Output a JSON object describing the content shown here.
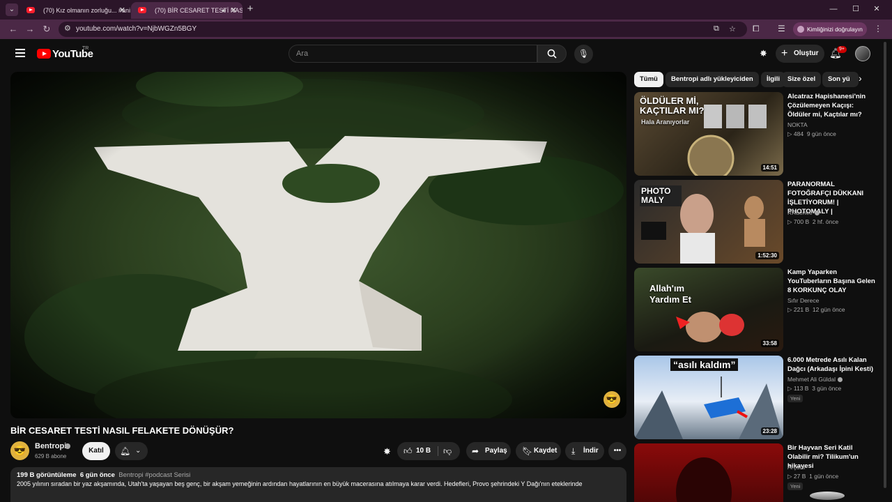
{
  "browser": {
    "tabs": [
      {
        "title": "(70) Kız olmanın zorluğu... #ani",
        "active": false
      },
      {
        "title": "(70) BİR CESARET TESTİ NASIL FELAKETE DÖNÜŞÜR?",
        "active": true
      }
    ],
    "url": "youtube.com/watch?v=NjbWGZn5BGY",
    "verify_label": "Kimliğinizi doğrulayın"
  },
  "header": {
    "logo": "YouTube",
    "country_code": "TR",
    "search_placeholder": "Ara",
    "create_label": "Oluştur",
    "notifications": "9+"
  },
  "video": {
    "title": "BİR CESARET TESTİ NASIL FELAKETE DÖNÜŞÜR?",
    "channel": "Bentropi",
    "subscribers": "629 B abone",
    "join_label": "Katıl",
    "likes": "10 B",
    "share_label": "Paylaş",
    "save_label": "Kaydet",
    "download_label": "İndir",
    "views": "199 B görüntüleme",
    "date": "6 gün önce",
    "tags": "Bentropi  #podcast Serisi",
    "description": "2005 yılının sıradan bir yaz akşamında, Utah'ta yaşayan beş genç, bir akşam yemeğinin ardından hayatlarının en büyük macerasına atılmaya karar verdi. Hedefleri, Provo şehrindeki Y Dağı'nın eteklerinde"
  },
  "chips": [
    "Tümü",
    "Bentropi adlı yükleyiciden",
    "İlgili",
    "Size özel",
    "Son yü"
  ],
  "recommendations": [
    {
      "title": "Alcatraz Hapishanesi'nin Çözülemeyen Kaçışı: Öldüler mi, Kaçtılar mı?",
      "channel": "NOKTA",
      "views": "▷ 484",
      "age": "9 gün önce",
      "duration": "14:51",
      "thumb_text": "ÖLDÜLER Mİ, KAÇTILAR MI?",
      "thumb_sub": "Hala Aranıyorlar",
      "verified": false,
      "new": ""
    },
    {
      "title": "PARANORMAL FOTOĞRAFÇI DÜKKANI İŞLETİYORUM! | PHOTOMALY |",
      "channel": "RRaenee",
      "views": "▷ 700 B",
      "age": "2 hf. önce",
      "duration": "1:52:30",
      "thumb_text": "PHOTO MALY",
      "thumb_sub": "",
      "verified": true,
      "new": ""
    },
    {
      "title": "Kamp Yaparken YouTuberların Başına Gelen 8 KORKUNÇ OLAY",
      "channel": "Sıfır Derece",
      "views": "▷ 221 B",
      "age": "12 gün önce",
      "duration": "33:58",
      "thumb_text": "Allah'ım Yardım Et",
      "thumb_sub": "",
      "verified": false,
      "new": ""
    },
    {
      "title": "6.000 Metrede Asılı Kalan Dağcı (Arkadaşı İpini Kesti)",
      "channel": "Mehmet Ali Güldal",
      "views": "▷ 113 B",
      "age": "3 gün önce",
      "duration": "23:28",
      "thumb_text": "“asılı kaldım”",
      "thumb_sub": "",
      "verified": true,
      "new": "Yeni"
    },
    {
      "title": "Bir Hayvan Seri Katil Olabilir mi?  Tilikum'un hikayesi",
      "channel": "Arçura",
      "views": "▷ 27 B",
      "age": "1 gün önce",
      "duration": "",
      "thumb_text": "",
      "thumb_sub": "",
      "verified": false,
      "new": "Yeni"
    }
  ]
}
